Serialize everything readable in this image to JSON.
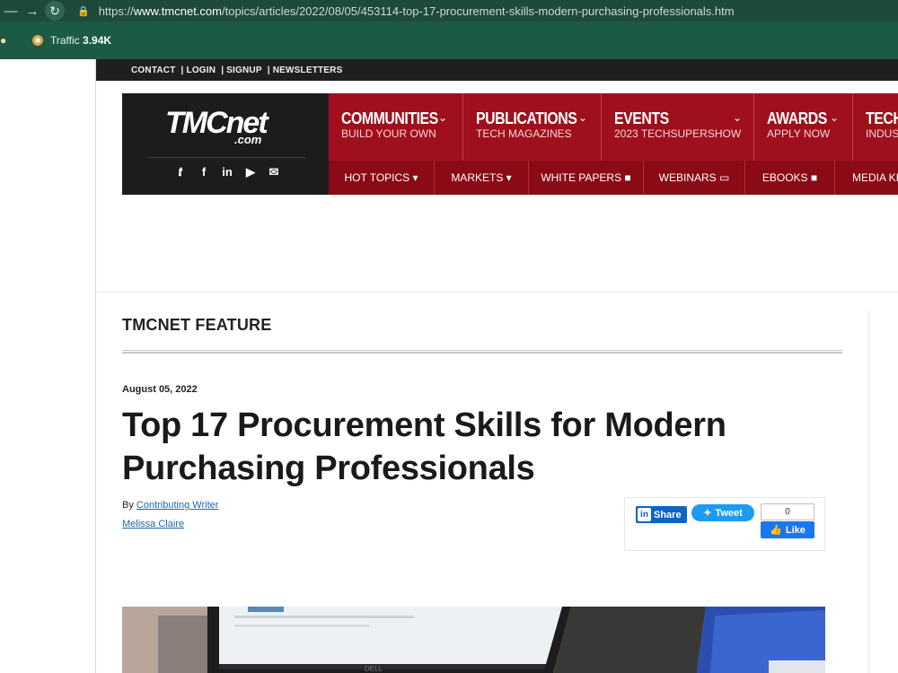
{
  "browser": {
    "url_prefix": "https://",
    "url_host": "www.tmcnet.com",
    "url_path": "/topics/articles/2022/08/05/453114-top-17-procurement-skills-modern-purchasing-professionals.htm",
    "bookmark_label": "Traffic",
    "bookmark_value": "3.94K"
  },
  "topbar": {
    "links": [
      "CONTACT",
      "| LOGIN",
      "| SIGNUP",
      "| NEWSLETTERS"
    ]
  },
  "logo": {
    "main": "TMCnet",
    "suffix": ".com"
  },
  "menu_top": [
    {
      "title": "COMMUNITIES",
      "sub": "BUILD YOUR OWN"
    },
    {
      "title": "PUBLICATIONS",
      "sub": "TECH MAGAZINES"
    },
    {
      "title": "EVENTS",
      "sub": "2023 TECHSUPERSHOW"
    },
    {
      "title": "AWARDS",
      "sub": "APPLY NOW"
    },
    {
      "title": "TECH",
      "sub": "INDUST"
    }
  ],
  "menu_bottom": [
    "HOT TOPICS ▾",
    "MARKETS ▾",
    "WHITE PAPERS ■",
    "WEBINARS ▭",
    "EBOOKS ■",
    "MEDIA KIT"
  ],
  "article": {
    "section": "TMCNET FEATURE",
    "date": "August 05, 2022",
    "title": "Top 17 Procurement Skills for Modern Purchasing Professionals",
    "by_prefix": "By",
    "by_author": "Contributing Writer",
    "by_name": "Melissa Claire"
  },
  "share": {
    "linkedin": "Share",
    "tweet": "Tweet",
    "fb_count": "0",
    "fb_like": "Like"
  },
  "colors": {
    "menu_red": "#a0101c",
    "menu_dark_red": "#8a0a15",
    "linkedin_blue": "#0a66c2",
    "twitter_blue": "#1d9bf0",
    "facebook_blue": "#1877f2"
  }
}
